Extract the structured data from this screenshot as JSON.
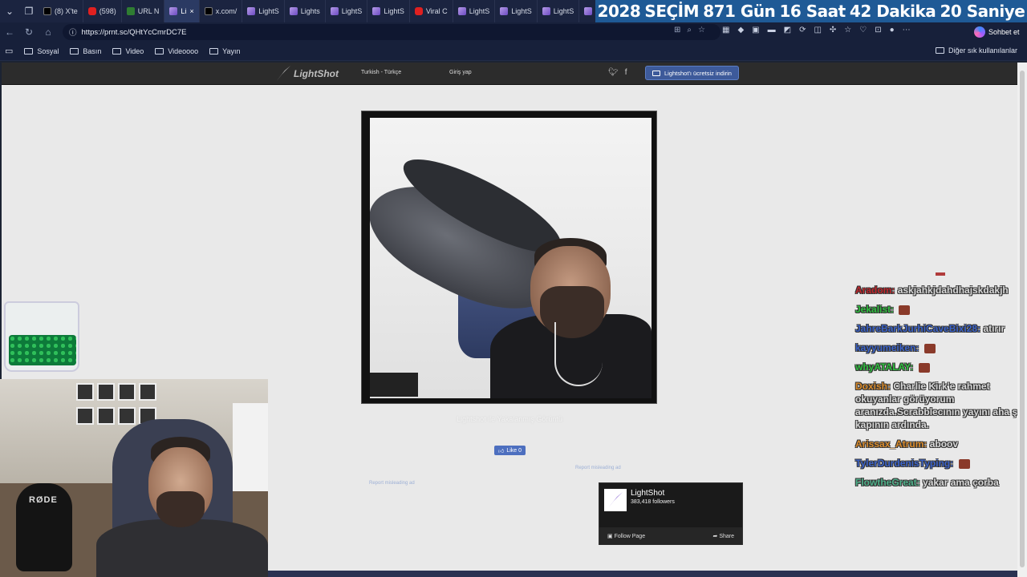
{
  "tabs": [
    {
      "label": "(8) X'te",
      "icon": "x"
    },
    {
      "label": "(598)",
      "icon": "yt"
    },
    {
      "label": "URL N",
      "icon": "url"
    },
    {
      "label": "Li",
      "icon": "ls",
      "active": true
    },
    {
      "label": "x.com/",
      "icon": "x"
    },
    {
      "label": "LightS",
      "icon": "ls"
    },
    {
      "label": "Lights",
      "icon": "ls"
    },
    {
      "label": "LightS",
      "icon": "ls"
    },
    {
      "label": "LightS",
      "icon": "ls"
    },
    {
      "label": "Viral C",
      "icon": "yt"
    },
    {
      "label": "LightS",
      "icon": "ls"
    },
    {
      "label": "LightS",
      "icon": "ls"
    },
    {
      "label": "LightS",
      "icon": "ls"
    },
    {
      "label": "LightS",
      "icon": "ls"
    },
    {
      "label": "x.com/",
      "icon": "x"
    }
  ],
  "banner": {
    "year": "2028",
    "election": "SEÇİM",
    "days": "871 Gün",
    "hours": "16 Saat",
    "minutes": "42 Dakika",
    "seconds": "20 Saniye",
    "color": "#1f5a96"
  },
  "address": {
    "url": "https://prnt.sc/QHtYcCmrDC7E"
  },
  "copilot": {
    "label": "Sohbet et"
  },
  "bookmarks": [
    "Sosyal",
    "Basın",
    "Video",
    "Videoooo",
    "Yayın"
  ],
  "bookmarks_other": "Diğer sık kullanılanlar",
  "lightshot": {
    "logo": "LightShot",
    "language": "Turkish - Türkçe",
    "login": "Giriş yap",
    "download": "Lightshot'ı ücretsiz indirin",
    "caption": "Lightshot ile Yakalanmış Görüntü",
    "like": "Like 0",
    "report1": "Report misleading ad",
    "report2": "Report misleading ad",
    "fb_name": "LightShot",
    "fb_followers": "383,418 followers",
    "fb_follow": "Follow Page",
    "fb_share": "Share"
  },
  "webcam": {
    "mic_label": "RØDE"
  },
  "chat": [
    {
      "user": "Aradom:",
      "text": "askjahkjdahdhajskdakjh",
      "color": "#c0262b"
    },
    {
      "user": "Jekalist:",
      "text": "",
      "color": "#2fbf3f"
    },
    {
      "user": "JahreBarkJurhiCaveBixi28:",
      "text": "atırır",
      "color": "#3b63c9"
    },
    {
      "user": "kayyumeiken:",
      "text": "",
      "color": "#3b63c9"
    },
    {
      "user": "whyATALAY:",
      "text": "",
      "color": "#2fbf3f"
    },
    {
      "user": "Doxish:",
      "text": "Charlie Kirk'e rahmet okuyanlar görüyorum aranızda.Scrabblecının yayını aha şu kapının ardında.",
      "color": "#d98b2b"
    },
    {
      "user": "Arissax_Atrum:",
      "text": "aboov",
      "color": "#d98b2b"
    },
    {
      "user": "TylerDurdenisTyping:",
      "text": "",
      "color": "#3b63c9"
    },
    {
      "user": "FlowtheGreat:",
      "text": "yakar ama çorba",
      "color": "#4fb08a"
    }
  ]
}
